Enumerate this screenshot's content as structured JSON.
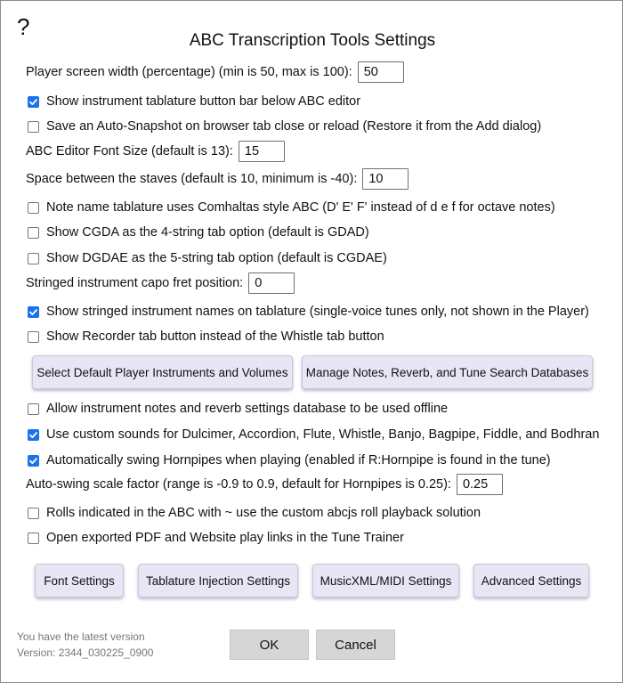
{
  "help": {
    "glyph": "?"
  },
  "title": "ABC Transcription Tools Settings",
  "settings": {
    "player_width": {
      "label": "Player screen width (percentage) (min is 50, max is 100):",
      "value": "50"
    },
    "tab_button_bar": {
      "label": "Show instrument tablature button bar below ABC editor",
      "checked": true
    },
    "auto_snapshot": {
      "label": "Save an Auto-Snapshot on browser tab close or reload (Restore it from the Add dialog)",
      "checked": false
    },
    "font_size": {
      "label": "ABC Editor Font Size (default is 13):",
      "value": "15"
    },
    "staff_space": {
      "label": "Space between the staves (default is 10, minimum is -40):",
      "value": "10"
    },
    "comhaltas": {
      "label": "Note name tablature uses Comhaltas style ABC (D' E' F' instead of d e f for octave notes)",
      "checked": false
    },
    "cgda": {
      "label": "Show CGDA as the 4-string tab option (default is GDAD)",
      "checked": false
    },
    "dgdae": {
      "label": "Show DGDAE as the 5-string tab option (default is CGDAE)",
      "checked": false
    },
    "capo": {
      "label": "Stringed instrument capo fret position:",
      "value": "0"
    },
    "instrument_names": {
      "label": "Show stringed instrument names on tablature (single-voice tunes only, not shown in the Player)",
      "checked": true
    },
    "recorder": {
      "label": "Show Recorder tab button instead of the Whistle tab button",
      "checked": false
    },
    "offline_db": {
      "label": "Allow instrument notes and reverb settings database to be used offline",
      "checked": false
    },
    "custom_sounds": {
      "label": "Use custom sounds for Dulcimer, Accordion, Flute, Whistle, Banjo, Bagpipe, Fiddle, and Bodhran",
      "checked": true
    },
    "swing_hornpipes": {
      "label": "Automatically swing Hornpipes when playing (enabled if R:Hornpipe is found in the tune)",
      "checked": true
    },
    "swing_factor": {
      "label": "Auto-swing scale factor (range is -0.9 to 0.9, default for Hornpipes is 0.25):",
      "value": "0.25"
    },
    "rolls": {
      "label": "Rolls indicated in the ABC with ~ use the custom abcjs roll playback solution",
      "checked": false
    },
    "tune_trainer": {
      "label": "Open exported PDF and Website play links in the Tune Trainer",
      "checked": false
    }
  },
  "buttons": {
    "default_instruments": "Select Default Player Instruments and Volumes",
    "manage_notes": "Manage Notes, Reverb, and Tune Search Databases",
    "font_settings": "Font Settings",
    "tablature_injection": "Tablature Injection Settings",
    "musicxml_midi": "MusicXML/MIDI Settings",
    "advanced": "Advanced Settings",
    "ok": "OK",
    "cancel": "Cancel"
  },
  "footer": {
    "latest": "You have the latest version",
    "version": "Version: 2344_030225_0900"
  },
  "colors": {
    "checkbox_accent": "#1a73e8",
    "button_bg": "#e8e6f5",
    "footer_button_bg": "#d6d6d6"
  }
}
